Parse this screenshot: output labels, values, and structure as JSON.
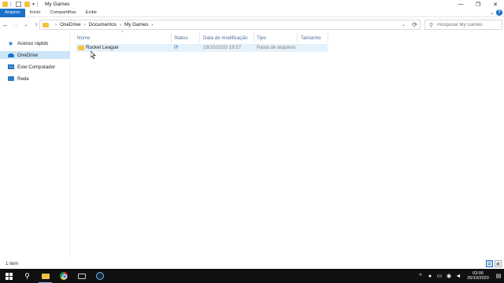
{
  "window": {
    "title": "My Games",
    "controls": {
      "minimize": "—",
      "maximize": "❐",
      "close": "✕"
    }
  },
  "ribbon": {
    "tabs": [
      {
        "label": "Arquivo",
        "active": true
      },
      {
        "label": "Início",
        "active": false
      },
      {
        "label": "Compartilhar",
        "active": false
      },
      {
        "label": "Exibir",
        "active": false
      }
    ],
    "help": "?",
    "expand": "⌄"
  },
  "nav": {
    "back": "←",
    "forward": "→",
    "recent": "⌄",
    "up": "↑"
  },
  "address": {
    "crumbs": [
      "OneDrive",
      "Documentos",
      "My Games"
    ],
    "separator": "›",
    "dropdown": "⌄",
    "refresh": "⟳"
  },
  "search": {
    "placeholder": "Pesquisar My Games",
    "icon": "search-icon"
  },
  "sidebar": {
    "items": [
      {
        "label": "Acesso rápido",
        "icon": "star-icon",
        "selected": false
      },
      {
        "label": "OneDrive",
        "icon": "cloud-icon",
        "selected": true
      },
      {
        "label": "Este Computador",
        "icon": "computer-icon",
        "selected": false
      },
      {
        "label": "Rede",
        "icon": "network-icon",
        "selected": false
      }
    ]
  },
  "columns": {
    "name": "Nome",
    "status": "Status",
    "modified": "Data de modificação",
    "type": "Tipo",
    "size": "Tamanho",
    "sort_indicator": "^"
  },
  "files": [
    {
      "name": "Rocket League",
      "status_icon": "sync-icon",
      "status_glyph": "⟳",
      "modified": "18/10/2020 19:57",
      "type": "Pasta de arquivos",
      "size": ""
    }
  ],
  "statusbar": {
    "count": "1 item"
  },
  "taskbar": {
    "pinned": [
      "start-button",
      "search-icon",
      "file-explorer-icon",
      "chrome-icon",
      "monitor-icon",
      "steam-icon"
    ],
    "tray": {
      "chevron": "^",
      "mic": "🎙",
      "network": "▭",
      "volume": "🔊",
      "notification": "▤"
    },
    "clock": {
      "time": "03:06",
      "date": "25/10/2020"
    }
  },
  "colors": {
    "accent": "#1a6fc9",
    "selection": "#cce4f7",
    "row_highlight": "#e5f1fb",
    "folder": "#f3c342",
    "taskbar": "#101010"
  }
}
